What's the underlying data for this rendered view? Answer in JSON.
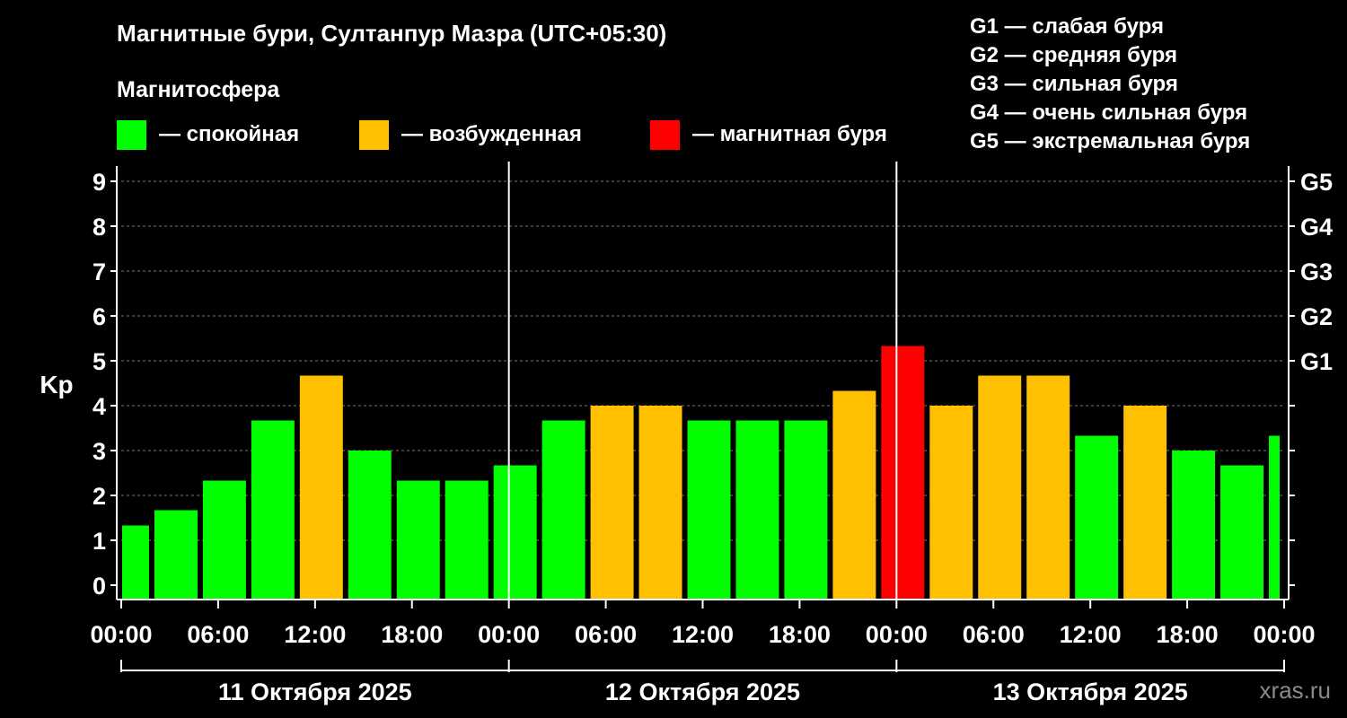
{
  "header": {
    "title": "Магнитные бури, Султанпур Мазра (UTC+05:30)",
    "magnetosphere_label": "Магнитосфера"
  },
  "legend": [
    {
      "label": "— спокойная",
      "color": "#00ff00"
    },
    {
      "label": "— возбужденная",
      "color": "#ffc000"
    },
    {
      "label": "— магнитная буря",
      "color": "#ff0000"
    }
  ],
  "g_scale": [
    "G1 — слабая буря",
    "G2 — средняя буря",
    "G3 — сильная буря",
    "G4 — очень сильная буря",
    "G5 — экстремальная буря"
  ],
  "watermark": "xras.ru",
  "chart_data": {
    "type": "bar",
    "ylabel": "Kp",
    "ylim": [
      0,
      9
    ],
    "yticks": [
      0,
      1,
      2,
      3,
      4,
      5,
      6,
      7,
      8,
      9
    ],
    "right_ticks": [
      {
        "value": 5,
        "label": "G1"
      },
      {
        "value": 6,
        "label": "G2"
      },
      {
        "value": 7,
        "label": "G3"
      },
      {
        "value": 8,
        "label": "G4"
      },
      {
        "value": 9,
        "label": "G5"
      }
    ],
    "xlim_hours": [
      0,
      72
    ],
    "xticks": [
      {
        "hour": 0,
        "label": "00:00"
      },
      {
        "hour": 6,
        "label": "06:00"
      },
      {
        "hour": 12,
        "label": "12:00"
      },
      {
        "hour": 18,
        "label": "18:00"
      },
      {
        "hour": 24,
        "label": "00:00"
      },
      {
        "hour": 30,
        "label": "06:00"
      },
      {
        "hour": 36,
        "label": "12:00"
      },
      {
        "hour": 42,
        "label": "18:00"
      },
      {
        "hour": 48,
        "label": "00:00"
      },
      {
        "hour": 54,
        "label": "06:00"
      },
      {
        "hour": 60,
        "label": "12:00"
      },
      {
        "hour": 66,
        "label": "18:00"
      },
      {
        "hour": 72,
        "label": "00:00"
      }
    ],
    "days": [
      {
        "label": "11 Октября 2025",
        "start": 0,
        "end": 24
      },
      {
        "label": "12 Октября 2025",
        "start": 24,
        "end": 48
      },
      {
        "label": "13 Октября 2025",
        "start": 48,
        "end": 72
      }
    ],
    "grid": true,
    "bars": [
      {
        "start": 0,
        "end": 2,
        "kp": 1.33,
        "level": "quiet"
      },
      {
        "start": 2,
        "end": 5,
        "kp": 1.67,
        "level": "quiet"
      },
      {
        "start": 5,
        "end": 8,
        "kp": 2.33,
        "level": "quiet"
      },
      {
        "start": 8,
        "end": 11,
        "kp": 3.67,
        "level": "quiet"
      },
      {
        "start": 11,
        "end": 14,
        "kp": 4.67,
        "level": "active"
      },
      {
        "start": 14,
        "end": 17,
        "kp": 3.0,
        "level": "quiet"
      },
      {
        "start": 17,
        "end": 20,
        "kp": 2.33,
        "level": "quiet"
      },
      {
        "start": 20,
        "end": 23,
        "kp": 2.33,
        "level": "quiet"
      },
      {
        "start": 23,
        "end": 26,
        "kp": 2.67,
        "level": "quiet"
      },
      {
        "start": 26,
        "end": 29,
        "kp": 3.67,
        "level": "quiet"
      },
      {
        "start": 29,
        "end": 32,
        "kp": 4.0,
        "level": "active"
      },
      {
        "start": 32,
        "end": 35,
        "kp": 4.0,
        "level": "active"
      },
      {
        "start": 35,
        "end": 38,
        "kp": 3.67,
        "level": "quiet"
      },
      {
        "start": 38,
        "end": 41,
        "kp": 3.67,
        "level": "quiet"
      },
      {
        "start": 41,
        "end": 44,
        "kp": 3.67,
        "level": "quiet"
      },
      {
        "start": 44,
        "end": 47,
        "kp": 4.33,
        "level": "active"
      },
      {
        "start": 47,
        "end": 50,
        "kp": 5.33,
        "level": "storm"
      },
      {
        "start": 50,
        "end": 53,
        "kp": 4.0,
        "level": "active"
      },
      {
        "start": 53,
        "end": 56,
        "kp": 4.67,
        "level": "active"
      },
      {
        "start": 56,
        "end": 59,
        "kp": 4.67,
        "level": "active"
      },
      {
        "start": 59,
        "end": 62,
        "kp": 3.33,
        "level": "quiet"
      },
      {
        "start": 62,
        "end": 65,
        "kp": 4.0,
        "level": "active"
      },
      {
        "start": 65,
        "end": 68,
        "kp": 3.0,
        "level": "quiet"
      },
      {
        "start": 68,
        "end": 71,
        "kp": 2.67,
        "level": "quiet"
      },
      {
        "start": 71,
        "end": 72,
        "kp": 3.33,
        "level": "quiet"
      }
    ],
    "level_colors": {
      "quiet": "#00ff00",
      "active": "#ffc000",
      "storm": "#ff0000"
    }
  }
}
